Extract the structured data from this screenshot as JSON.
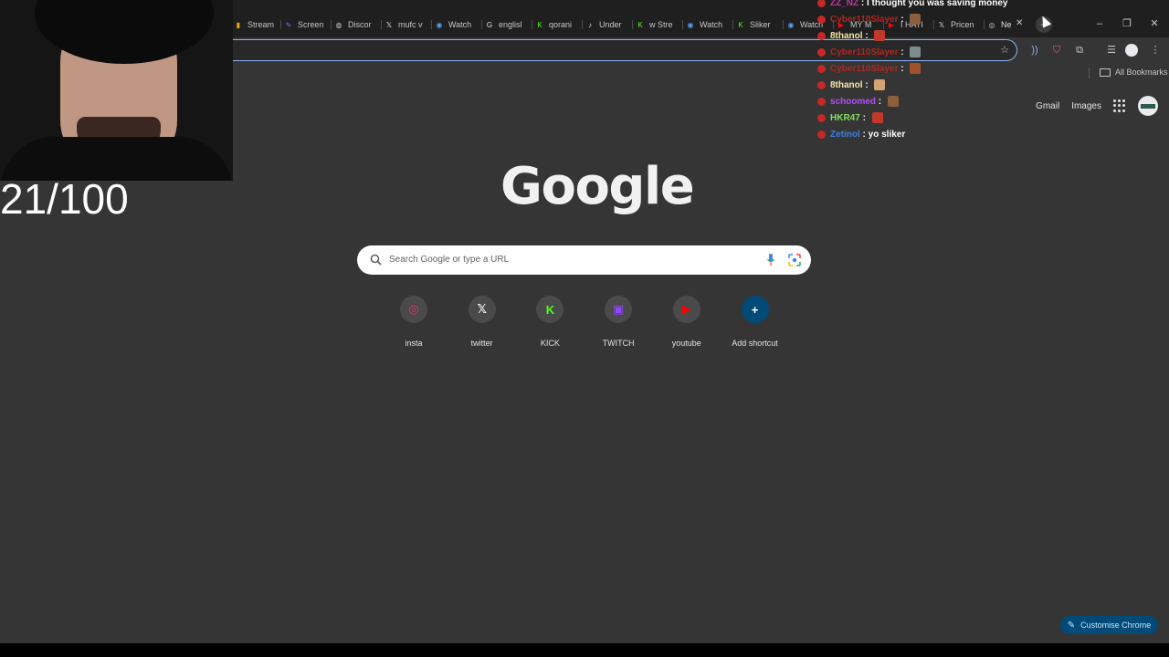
{
  "tabs": [
    {
      "label": "Stream",
      "icon": "bar-chart-icon",
      "color": "#f2a60c"
    },
    {
      "label": "Screen",
      "icon": "pen-icon",
      "color": "#a259ff"
    },
    {
      "label": "Discor",
      "icon": "globe-icon",
      "color": "#c7c7c7"
    },
    {
      "label": "mufc v",
      "icon": "x-logo-icon",
      "color": "#e3e3e3"
    },
    {
      "label": "Watch",
      "icon": "play-circle-icon",
      "color": "#4da3ff"
    },
    {
      "label": "englisl",
      "icon": "google-g-icon",
      "color": "#e3e3e3"
    },
    {
      "label": "qorani",
      "icon": "kick-icon",
      "color": "#53fc18"
    },
    {
      "label": "Under",
      "icon": "tiktok-icon",
      "color": "#e3e3e3"
    },
    {
      "label": "w Stre",
      "icon": "kick-icon",
      "color": "#53fc18"
    },
    {
      "label": "Watch",
      "icon": "play-circle-icon",
      "color": "#4da3ff"
    },
    {
      "label": "Sliker",
      "icon": "kick-icon",
      "color": "#53fc18"
    },
    {
      "label": "Watch",
      "icon": "play-circle-icon",
      "color": "#4da3ff"
    },
    {
      "label": "MY M",
      "icon": "youtube-icon",
      "color": "#ff0000"
    },
    {
      "label": "I HATI",
      "icon": "youtube-icon",
      "color": "#ff0000"
    },
    {
      "label": "Pricen",
      "icon": "x-logo-icon",
      "color": "#e3e3e3"
    },
    {
      "label": "Ne",
      "icon": "chrome-icon",
      "color": "#c7c7c7",
      "active": true
    }
  ],
  "tab_close_label": "✕",
  "new_tab_label": "+",
  "window_controls": {
    "minimize": "–",
    "maximize": "❐",
    "close": "✕"
  },
  "bookmarks": {
    "all_bookmarks_label": "All Bookmarks"
  },
  "header_links": {
    "gmail": "Gmail",
    "images": "Images"
  },
  "logo_text": "Google",
  "search": {
    "placeholder": "Search Google or type a URL"
  },
  "shortcuts": [
    {
      "label": "insta",
      "icon": "instagram-icon",
      "color": "#e1306c"
    },
    {
      "label": "twitter",
      "icon": "x-logo-icon",
      "color": "#ffffff"
    },
    {
      "label": "KICK",
      "icon": "kick-icon",
      "color": "#53fc18"
    },
    {
      "label": "TWITCH",
      "icon": "twitch-icon",
      "color": "#9146ff"
    },
    {
      "label": "youtube",
      "icon": "youtube-icon",
      "color": "#ff0000"
    },
    {
      "label": "Add shortcut",
      "icon": "plus-icon",
      "color": "#ffffff"
    }
  ],
  "stream_overlay": {
    "counter_text": "21/100",
    "chat": [
      {
        "user": "ZZ_NZ",
        "message": "I thought you was saving money",
        "user_color": "#c43aa8"
      },
      {
        "user": "Cyber110Slayer",
        "message": "",
        "user_color": "#b3261e",
        "emote": true
      },
      {
        "user": "8thanol",
        "message": "",
        "user_color": "#f5e6a8",
        "emote": true
      },
      {
        "user": "Cyber110Slayer",
        "message": "",
        "user_color": "#b3261e",
        "emote": true
      },
      {
        "user": "Cyber110Slayer",
        "message": "",
        "user_color": "#b3261e",
        "emote": true
      },
      {
        "user": "8thanol",
        "message": "",
        "user_color": "#f5e6a8",
        "emote": true
      },
      {
        "user": "schoomed",
        "message": "",
        "user_color": "#b14cff",
        "emote": true
      },
      {
        "user": "HKR47",
        "message": "",
        "user_color": "#7ee05c",
        "emote": true
      },
      {
        "user": "Zetinol",
        "message": "yo sliker",
        "user_color": "#3d7fe0"
      }
    ]
  },
  "customise_button": {
    "label": "Customise Chrome"
  }
}
